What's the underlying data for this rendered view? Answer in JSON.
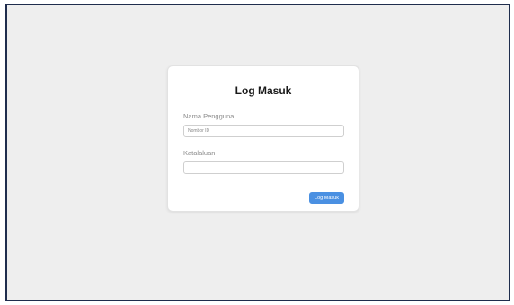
{
  "login_form": {
    "title": "Log Masuk",
    "username": {
      "label": "Nama Pengguna",
      "placeholder": "Nombor ID",
      "value": ""
    },
    "password": {
      "label": "Katalaluan",
      "placeholder": "",
      "value": ""
    },
    "submit_label": "Log Masuk"
  },
  "colors": {
    "page_background": "#eeeeee",
    "frame_border": "#1f2d4d",
    "card_background": "#ffffff",
    "button_accent": "#4a90e2",
    "label_text": "#8a8a8a"
  }
}
